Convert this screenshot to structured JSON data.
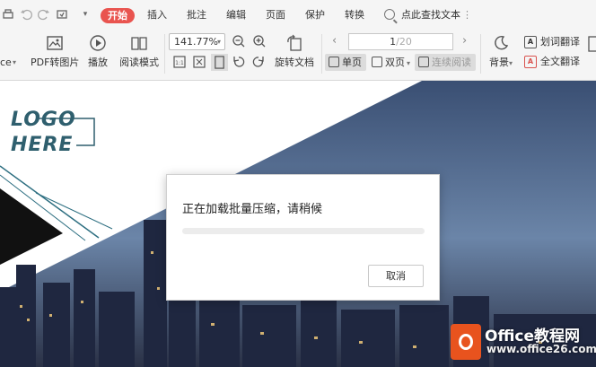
{
  "menu": {
    "tabs": [
      {
        "label": "开始",
        "active": true
      },
      {
        "label": "插入"
      },
      {
        "label": "批注"
      },
      {
        "label": "编辑"
      },
      {
        "label": "页面"
      },
      {
        "label": "保护"
      },
      {
        "label": "转换"
      }
    ],
    "search_label": "点此查找文本"
  },
  "toolbar": {
    "partial_left_label": "ce",
    "pdf_to_image": "PDF转图片",
    "play": "播放",
    "reading_mode": "阅读模式",
    "zoom_value": "141.77%",
    "rotate_doc": "旋转文档",
    "page_current": "1",
    "page_total": "/20",
    "single_page": "单页",
    "double_page": "双页",
    "continuous_read": "连续阅读",
    "background": "背景",
    "word_translate": "划词翻译",
    "full_translate": "全文翻译"
  },
  "document": {
    "logo_line1": "LOGO",
    "logo_line2": "HERE"
  },
  "dialog": {
    "message": "正在加载批量压缩，请稍候",
    "progress": 0,
    "cancel_label": "取消"
  },
  "watermark": {
    "title": "Office教程网",
    "url": "www.office26.com"
  },
  "colors": {
    "accent_tab": "#e9544f",
    "logo": "#2f5f6e",
    "watermark_logo": "#e8531e"
  }
}
